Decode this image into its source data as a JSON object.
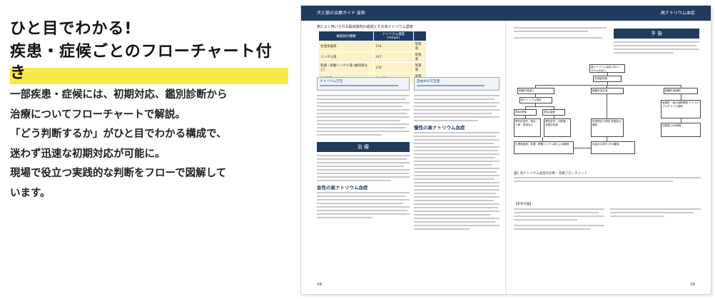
{
  "heading": {
    "line1": "ひと目でわかる!",
    "line2": "疾患・症候ごとのフローチャート付き"
  },
  "description": [
    "一部疾患・症候には、初期対応、鑑別診断から",
    "治療についてフローチャートで解説。",
    "「どう判断するか」がひと目でわかる構成で、",
    "迷わず迅速な初期対応が可能に。",
    "現場で役立つ実践的な判断をフローで図解して",
    "います。"
  ],
  "spread": {
    "header_left": "犬と猫の治療ガイド 抜粋",
    "header_right": "高ナトリウム血症",
    "table_caption": "表2 よく用いられる輸液製剤の組成とその高ナトリウム濃度",
    "table_head": [
      "輸液剤の種類",
      "ナトリウム濃度 (mEq/L)",
      ""
    ],
    "table_rows": [
      [
        "生理食塩液",
        "154",
        "等張液"
      ],
      [
        "リンゲル液",
        "147",
        "等張液"
      ],
      [
        "乳酸・酢酸リンゲル液 (維持液など)",
        "130",
        "等張液"
      ],
      [
        "5%糖液",
        "90 - 70",
        "低張液"
      ]
    ],
    "left_box_title": "ナトリウム欠乏",
    "section_title": "治 療",
    "sub_heading_left": "急性の高ナトリウム血症",
    "mid_box_title": "自由水の欠乏量",
    "mid_sub_heading": "慢性の高ナトリウム血症",
    "prognosis_title": "予 後",
    "fc_top": "高ナトリウム血症 (Na > 155 mEq/L)",
    "fc_nodes": {
      "n1": "体液量評価",
      "n2": "細胞外液減少",
      "n3": "細胞外液正常",
      "n4": "細胞外液過剰",
      "n5": "尿ナトリウム測定",
      "n6": "尿Na低値",
      "n7": "尿Na高値",
      "n8": "腎外性喪失：嘔吐・下痢・熱傷など",
      "n9": "腎性喪失：利尿薬・浸透圧利尿",
      "n10": "尿浸透圧の測定 尿崩症の鑑別",
      "n11": "医原性・塩分過剰摂取 ミネラルコルチコイド過剰",
      "n12": "生理食塩液、乳酸・酢酸リンゲル液による輸液",
      "n13": "自由水の投与 (5%糖液)",
      "n14": "利尿薬とNa制限"
    },
    "fc_caption": "図1 高ナトリウム血症の診断・治療フローチャート",
    "references_title": "【参考文献】",
    "page_left": "28",
    "page_right": "29"
  }
}
